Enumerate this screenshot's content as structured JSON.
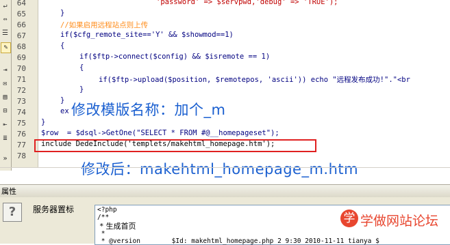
{
  "editor": {
    "line_numbers": [
      "64",
      "65",
      "66",
      "67",
      "68",
      "69",
      "70",
      "71",
      "72",
      "73",
      "74",
      "75",
      "76",
      "77",
      "78"
    ],
    "lines": {
      "l64_text": "'password' => $servpwd,'debug' => 'TRUE');",
      "l65_text": "}",
      "l66_comment": "//如果启用远程站点则上传",
      "l67_text": "if($cfg_remote_site=='Y' && $showmod==1)",
      "l68_text": "{",
      "l69_text": "if($ftp->connect($config) && $isremote == 1)",
      "l70_text": "{",
      "l71_text": "if($ftp->upload($position, $remotepos, 'ascii')) echo \"远程发布成功!\".\"<br",
      "l72_text": "}",
      "l73_text": "}",
      "l74_text": "ex",
      "l75_text": "}",
      "l76_text": "$row  = $dsql->GetOne(\"SELECT * FROM #@__homepageset\");",
      "l77_text": "include DedeInclude('templets/makehtml_homepage.htm');"
    }
  },
  "annotations": {
    "caption_top": "修改模版名称：加个_m",
    "caption_bottom": "修改后：makehtml_homepage_m.htm"
  },
  "properties_panel": {
    "title": "属性",
    "help_icon": "?",
    "label": "服务器置标",
    "source_lines": [
      "<?php",
      "/**",
      " * 生成首页",
      " *",
      " * @version        $Id: makehtml_homepage.php 2 9:30 2010-11-11 tianya $"
    ]
  },
  "watermark": {
    "icon_char": "学",
    "text": "学做网站论坛",
    "color": "#e8462f"
  },
  "colors": {
    "keyword": "#000080",
    "string": "#c00000",
    "comment": "#ff8c1a",
    "caption": "#1a5fd0",
    "highlight_border": "#e02020"
  }
}
